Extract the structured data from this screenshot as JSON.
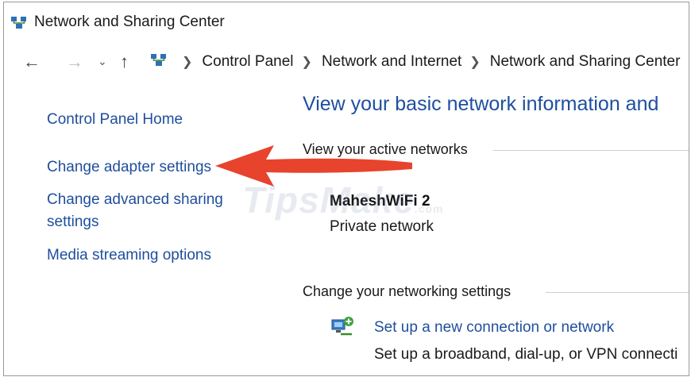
{
  "window": {
    "title": "Network and Sharing Center"
  },
  "address": {
    "breadcrumbs": [
      "Control Panel",
      "Network and Internet",
      "Network and Sharing Center"
    ]
  },
  "sidebar": {
    "items": [
      {
        "label": "Control Panel Home"
      },
      {
        "label": "Change adapter settings"
      },
      {
        "label": "Change advanced sharing"
      },
      {
        "label": "settings"
      },
      {
        "label": "Media streaming options"
      }
    ]
  },
  "main": {
    "heading": "View your basic network information and",
    "active_networks_label": "View your active networks",
    "network": {
      "name": "MaheshWiFi 2",
      "type": "Private network"
    },
    "change_settings_label": "Change your networking settings",
    "setup": {
      "link": "Set up a new connection or network",
      "description": "Set up a broadband, dial-up, or VPN connecti"
    }
  },
  "watermark": {
    "text": "TipsMake",
    "suffix": ".com"
  },
  "colors": {
    "link": "#1f4e9c",
    "heading": "#1e4fa0",
    "arrow": "#e8432d"
  }
}
